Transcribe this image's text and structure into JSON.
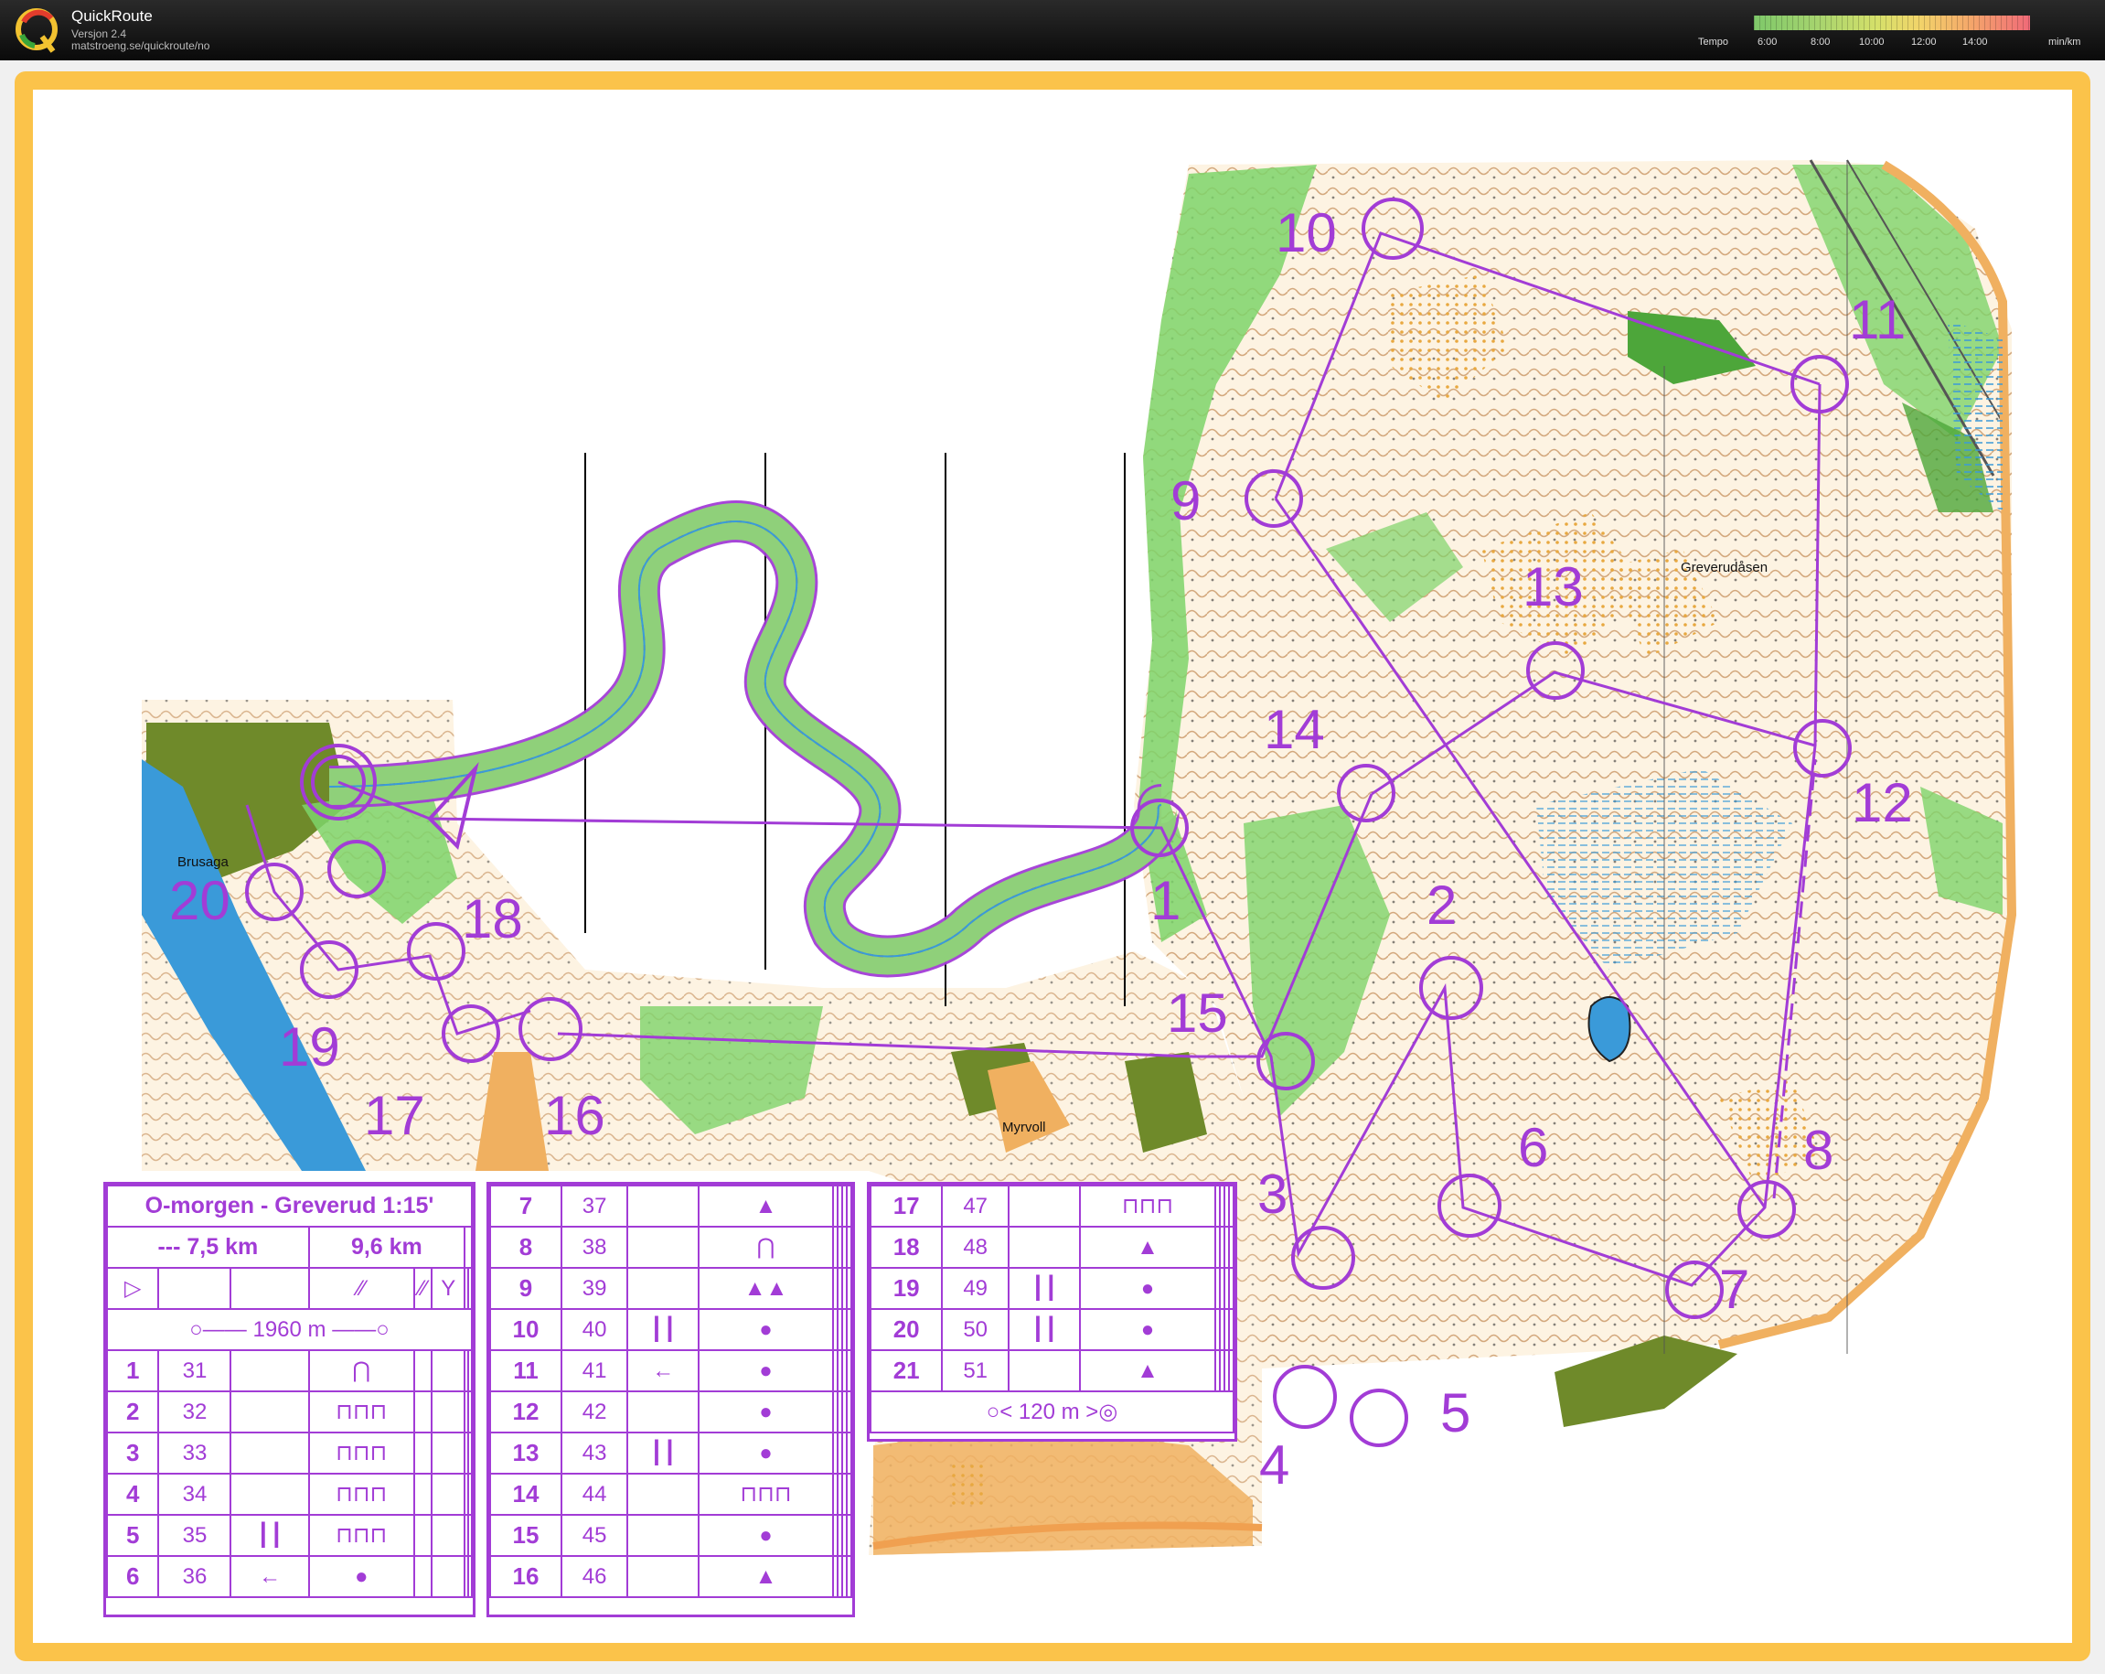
{
  "app": {
    "title": "QuickRoute",
    "version": "Versjon 2.4",
    "url": "matstroeng.se/quickroute/no",
    "logo_letter": "Q"
  },
  "tempo": {
    "label": "Tempo",
    "ticks": [
      "6:00",
      "8:00",
      "10:00",
      "12:00",
      "14:00"
    ],
    "unit": "min/km"
  },
  "map": {
    "place_labels": [
      "Brusaga",
      "Greverudåsen",
      "Myrvoll"
    ],
    "control_numbers": [
      "1",
      "2",
      "3",
      "4",
      "5",
      "6",
      "7",
      "8",
      "9",
      "10",
      "11",
      "12",
      "13",
      "14",
      "15",
      "16",
      "17",
      "18",
      "19",
      "20"
    ],
    "colors": {
      "course": "#a23cd6",
      "frame": "#fbc34a",
      "forest": "#66cc55"
    }
  },
  "sheet1": {
    "title": "O-morgen - Greverud 1:15'",
    "dist_a": "--- 7,5 km",
    "dist_b": "9,6 km",
    "start_tape": "1960 m",
    "rows": [
      {
        "n": "1",
        "code": "31",
        "d": "",
        "feat": "⋂",
        "loc": ""
      },
      {
        "n": "2",
        "code": "32",
        "d": "",
        "feat": "⊓⊓⊓",
        "loc": ""
      },
      {
        "n": "3",
        "code": "33",
        "d": "",
        "feat": "⊓⊓⊓",
        "loc": ""
      },
      {
        "n": "4",
        "code": "34",
        "d": "",
        "feat": "⊓⊓⊓",
        "loc": ""
      },
      {
        "n": "5",
        "code": "35",
        "d": "┃┃",
        "feat": "⊓⊓⊓",
        "loc": ""
      },
      {
        "n": "6",
        "code": "36",
        "d": "←",
        "feat": "●",
        "loc": ""
      }
    ]
  },
  "sheet2": {
    "rows": [
      {
        "n": "7",
        "code": "37",
        "d": "",
        "feat": "▲"
      },
      {
        "n": "8",
        "code": "38",
        "d": "",
        "feat": "⋂"
      },
      {
        "n": "9",
        "code": "39",
        "d": "",
        "feat": "▲▲"
      },
      {
        "n": "10",
        "code": "40",
        "d": "┃┃",
        "feat": "●"
      },
      {
        "n": "11",
        "code": "41",
        "d": "←",
        "feat": "●"
      },
      {
        "n": "12",
        "code": "42",
        "d": "",
        "feat": "●"
      },
      {
        "n": "13",
        "code": "43",
        "d": "┃┃",
        "feat": "●"
      },
      {
        "n": "14",
        "code": "44",
        "d": "",
        "feat": "⊓⊓⊓"
      },
      {
        "n": "15",
        "code": "45",
        "d": "",
        "feat": "●"
      },
      {
        "n": "16",
        "code": "46",
        "d": "",
        "feat": "▲"
      }
    ]
  },
  "sheet3": {
    "rows": [
      {
        "n": "17",
        "code": "47",
        "d": "",
        "feat": "⊓⊓⊓"
      },
      {
        "n": "18",
        "code": "48",
        "d": "",
        "feat": "▲"
      },
      {
        "n": "19",
        "code": "49",
        "d": "┃┃",
        "feat": "●"
      },
      {
        "n": "20",
        "code": "50",
        "d": "┃┃",
        "feat": "●"
      },
      {
        "n": "21",
        "code": "51",
        "d": "",
        "feat": "▲"
      }
    ],
    "finish_tape": "120 m"
  }
}
